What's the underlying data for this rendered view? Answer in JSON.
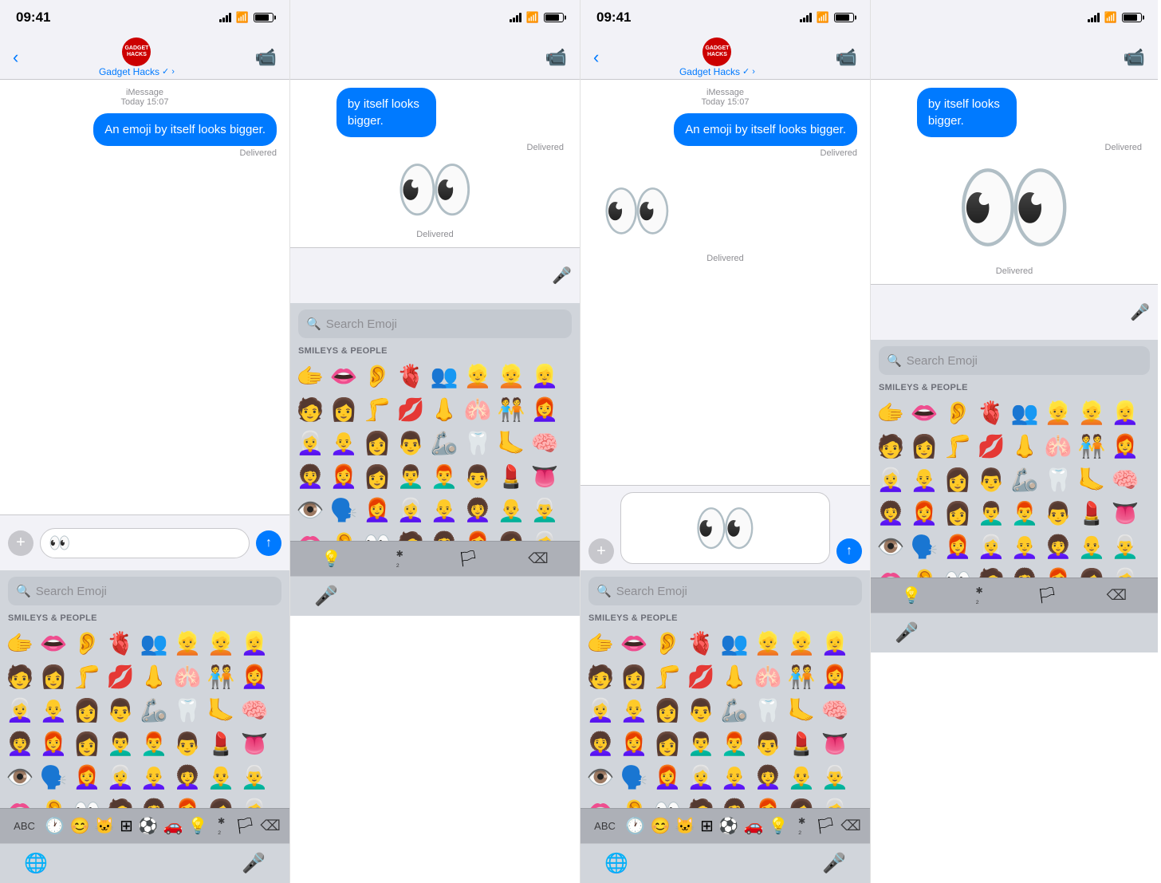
{
  "phones": [
    {
      "id": "phone-1",
      "status_time": "09:41",
      "nav_back": "‹",
      "nav_title": "Gadget Hacks",
      "nav_verified": "✓",
      "nav_chevron": "›",
      "message_label": "iMessage",
      "message_date": "Today 15:07",
      "message_text": "An emoji by itself looks bigger.",
      "message_delivered": "Delivered",
      "input_emoji": "👀",
      "emoji_search_placeholder": "Search Emoji",
      "emoji_category": "SMILEYS & PEOPLE",
      "emojis": [
        "🫱",
        "👄",
        "👂",
        "🫀",
        "👥",
        "👱",
        "👱",
        "👱",
        "👩",
        "👩",
        "🦵",
        "💋",
        "👃",
        "🫁",
        "🧑",
        "👩",
        "👩",
        "👩",
        "👩",
        "👩",
        "🦾",
        "🦷",
        "🦶",
        "🧠",
        "👩",
        "👩",
        "👩",
        "👩",
        "👩",
        "💄",
        "👅",
        "👁️",
        "🗣️",
        "👩",
        "👩",
        "👩",
        "👩",
        "👩",
        "👄",
        "👂",
        "👀",
        "🧑",
        "👩",
        "👩",
        "👩",
        "👩"
      ],
      "toolbar_items": [
        "ABC",
        "🕐",
        "😊",
        "🐱",
        "⊞",
        "⚽",
        "🚗",
        "💡",
        "✱₂",
        "🏳",
        "⌫"
      ],
      "keyboard_bottom": [
        "🌐",
        "🎤"
      ]
    },
    {
      "id": "phone-2",
      "status_time": "09:41",
      "nav_back": "‹",
      "nav_title": "Gadget Hacks",
      "nav_verified": "✓",
      "nav_chevron": "›",
      "message_label": "iMessage",
      "message_date": "Today 15:07",
      "message_text": "An emoji by itself looks bigger.",
      "message_delivered_1": "Delivered",
      "message_delivered_2": "Delivered",
      "input_emoji": "👀",
      "emoji_search_placeholder": "Search Emoji",
      "emoji_category": "SMILEYS & PEOPLE",
      "emojis": [
        "🫱",
        "👄",
        "👂",
        "🫀",
        "👥",
        "👱",
        "👱",
        "👱",
        "👩",
        "👩",
        "🦵",
        "💋",
        "👃",
        "🫁",
        "🧑",
        "👩",
        "👩",
        "👩",
        "👩",
        "👩",
        "🦾",
        "🦷",
        "🦶",
        "🧠",
        "👩",
        "👩",
        "👩",
        "👩",
        "👩",
        "💄",
        "👅",
        "👁️",
        "🗣️",
        "👩",
        "👩",
        "👩",
        "👩",
        "👩",
        "👄",
        "👂",
        "👀",
        "🧑",
        "👩",
        "👩",
        "👩",
        "👩"
      ],
      "toolbar_items": [
        "ABC",
        "🕐",
        "😊",
        "🐱",
        "⊞",
        "⚽",
        "🚗",
        "💡",
        "✱₂",
        "🏳",
        "⌫"
      ],
      "keyboard_bottom": [
        "🌐",
        "🎤"
      ]
    }
  ],
  "colors": {
    "ios_blue": "#007aff",
    "ios_gray": "#f2f2f7",
    "keyboard_bg": "#d1d5db",
    "message_bubble": "#007aff"
  },
  "labels": {
    "abc": "ABC",
    "delivered": "Delivered",
    "imessage": "iMessage",
    "search_emoji": "Search Emoji",
    "smileys_people": "SMILEYS & PEOPLE",
    "back_arrow": "‹",
    "video_icon": "📹",
    "plus_icon": "+",
    "delete_icon": "⌫",
    "globe_icon": "🌐",
    "mic_icon": "🎤"
  }
}
